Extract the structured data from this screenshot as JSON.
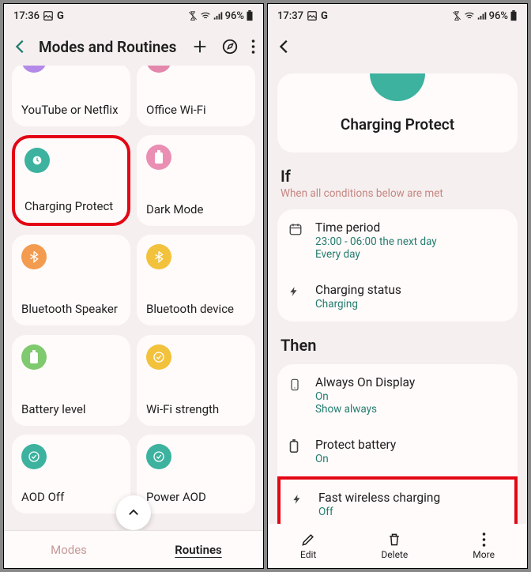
{
  "left": {
    "status": {
      "time": "17:36",
      "battery": "96%"
    },
    "header": {
      "title": "Modes and Routines"
    },
    "cards": [
      {
        "title": "YouTube or Netflix",
        "color": "#b48ae8"
      },
      {
        "title": "Office Wi-Fi",
        "color": "#e487ad"
      },
      {
        "title": "Charging Protect",
        "color": "#3cb29f",
        "highlight": true
      },
      {
        "title": "Dark Mode",
        "color": "#ea8fb3"
      },
      {
        "title": "Bluetooth Speaker",
        "color": "#f39b4e"
      },
      {
        "title": "Bluetooth device",
        "color": "#f2c23c"
      },
      {
        "title": "Battery level",
        "color": "#7fc96e"
      },
      {
        "title": "Wi-Fi strength",
        "color": "#f2c23c"
      },
      {
        "title": "AOD Off",
        "color": "#3cb29f"
      },
      {
        "title": "Power AOD",
        "color": "#3cb29f"
      }
    ],
    "tabs": {
      "modes": "Modes",
      "routines": "Routines"
    }
  },
  "right": {
    "status": {
      "time": "17:37",
      "battery": "96%"
    },
    "hero": {
      "title": "Charging Protect"
    },
    "if_label": "If",
    "if_sub": "When all conditions below are met",
    "then_label": "Then",
    "conditions": [
      {
        "title": "Time period",
        "sub": "23:00 - 06:00 the next day",
        "sub2": "Every day",
        "icon": "calendar"
      },
      {
        "title": "Charging status",
        "sub": "Charging",
        "icon": "bolt"
      }
    ],
    "actions": [
      {
        "title": "Always On Display",
        "sub": "On",
        "sub2": "Show always",
        "icon": "phone"
      },
      {
        "title": "Protect battery",
        "sub": "On",
        "icon": "battery"
      },
      {
        "title": "Fast wireless charging",
        "sub": "Off",
        "icon": "bolt",
        "highlight": true
      }
    ],
    "bottom": {
      "edit": "Edit",
      "delete": "Delete",
      "more": "More"
    }
  }
}
